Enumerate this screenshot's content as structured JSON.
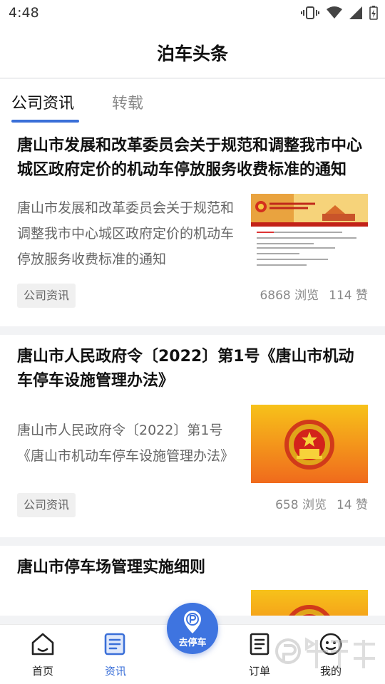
{
  "status": {
    "time": "4:48"
  },
  "header": {
    "title": "泊车头条"
  },
  "tabs": [
    {
      "label": "公司资讯",
      "active": true
    },
    {
      "label": "转载",
      "active": false
    }
  ],
  "articles": [
    {
      "title": "唐山市发展和改革委员会关于规范和调整我市中心城区政府定价的机动车停放服务收费标准的通知",
      "summary": "唐山市发展和改革委员会关于规范和调整我市中心城区政府定价的机动车停放服务收费标准的通知",
      "tag": "公司资讯",
      "views": "6868 浏览",
      "likes": "114 赞",
      "thumb": "webpage-screenshot"
    },
    {
      "title": "唐山市人民政府令〔2022〕第1号《唐山市机动车停车设施管理办法》",
      "summary": "唐山市人民政府令〔2022〕第1号《唐山市机动车停车设施管理办法》",
      "tag": "公司资讯",
      "views": "658 浏览",
      "likes": "14 赞",
      "thumb": "national-emblem"
    },
    {
      "title": "唐山市停车场管理实施细则",
      "thumb": "national-emblem"
    }
  ],
  "nav": {
    "items": [
      {
        "label": "首页",
        "icon": "home-icon",
        "active": false
      },
      {
        "label": "资讯",
        "icon": "news-icon",
        "active": true
      },
      {
        "label": "订单",
        "icon": "order-icon",
        "active": false
      },
      {
        "label": "我的",
        "icon": "profile-icon",
        "active": false
      }
    ],
    "fab_label": "去停车",
    "fab_icon": "parking-pin-icon"
  },
  "colors": {
    "accent": "#3a6fd8",
    "fab": "#3e74e0",
    "emblem_bg_top": "#f7c21a",
    "emblem_bg_bottom": "#f06a1c"
  }
}
